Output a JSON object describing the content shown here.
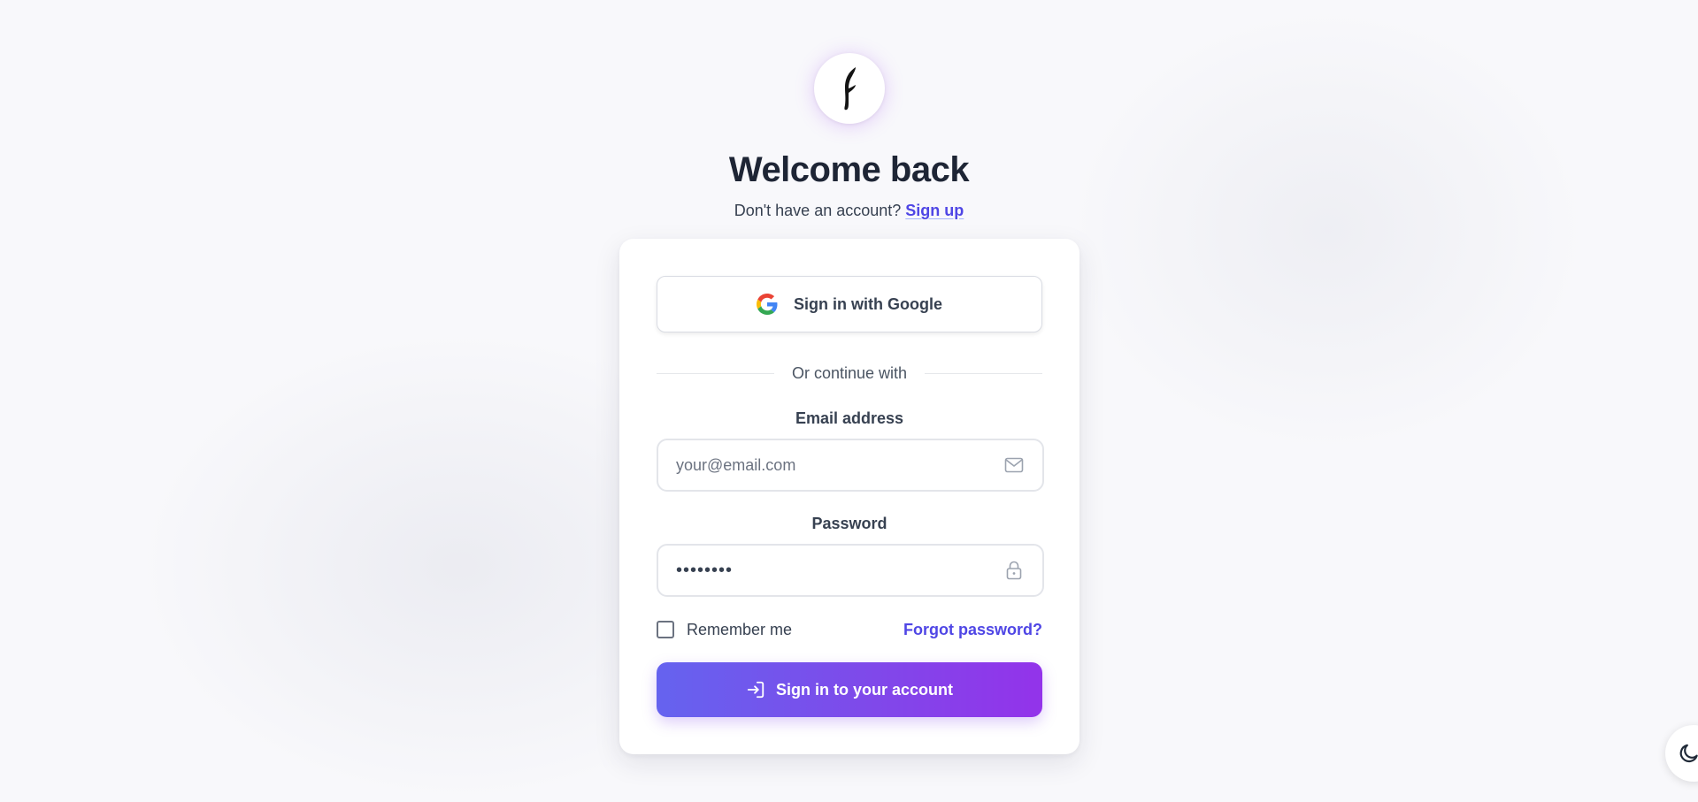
{
  "brand": {
    "logo_icon": "quill-feather-icon"
  },
  "header": {
    "title": "Welcome back",
    "signup_prompt": "Don't have an account?",
    "signup_link": "Sign up"
  },
  "card": {
    "google_button_label": "Sign in with Google",
    "divider_text": "Or continue with",
    "email": {
      "label": "Email address",
      "value": "",
      "placeholder": "your@email.com",
      "icon": "mail-icon"
    },
    "password": {
      "label": "Password",
      "value_masked": "••••••••",
      "icon": "lock-icon"
    },
    "remember_label": "Remember me",
    "remember_checked": false,
    "forgot_link": "Forgot password?",
    "submit_label": "Sign in to your account",
    "submit_icon": "sign-in-icon"
  },
  "theme_toggle": {
    "icon": "moon-icon"
  },
  "colors": {
    "accent": "#4f46e5",
    "gradient_start": "#6563ef",
    "gradient_end": "#9333ea",
    "title": "#1e2535"
  }
}
